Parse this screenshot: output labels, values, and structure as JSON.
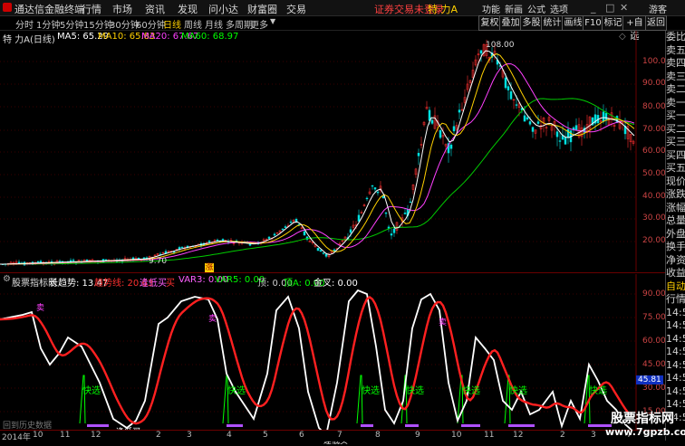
{
  "titlebar": {
    "app": "通达信金融终端",
    "menu": [
      "行情",
      "市场",
      "资讯",
      "发现",
      "问小达",
      "财富圈",
      "交易"
    ],
    "notice": "证券交易未登录",
    "stock_title": "特 力A",
    "right": [
      "功能",
      "新画",
      "公式",
      "选项"
    ],
    "guest": "游客"
  },
  "periodbar": {
    "periods": [
      "分时",
      "1分钟",
      "5分钟",
      "15分钟",
      "30分钟",
      "60分钟",
      "日线",
      "周线",
      "月线",
      "多周期",
      "更多"
    ],
    "active": "日线",
    "tools": [
      "复权",
      "叠加",
      "多股",
      "统计",
      "画线",
      "F10",
      "标记",
      "+自选",
      "返回"
    ]
  },
  "main": {
    "header": {
      "name": "特 力A(日线)",
      "ma5": "MA5: 65.29",
      "ma10": "MA10: 65.83",
      "ma20": "MA20: 67.67",
      "ma60": "MA60: 68.97"
    },
    "high_label": "108.00",
    "low_label": "9.70",
    "marker": "涨",
    "price_ticks": [
      "100.0",
      "90.00",
      "80.00",
      "70.00",
      "60.00",
      "50.00",
      "40.00",
      "30.00",
      "20.00"
    ]
  },
  "indicator": {
    "title": "股票指标网",
    "items": [
      {
        "text": "长趋势: 13.47",
        "color": "#ffffff"
      },
      {
        "text": "趋势线: 20.63",
        "color": "#ff3030"
      },
      {
        "text": "逢低买",
        "color": "#ff60ff"
      },
      {
        "text": "买",
        "color": "#ff3030"
      },
      {
        "text": "VAR3: 0.00",
        "color": "#ff60ff"
      },
      {
        "text": "VAR5: 0.00",
        "color": "#00ff00"
      },
      {
        "text": "顶: 0.00",
        "color": "#cccccc"
      },
      {
        "text": "顶A: 0.00",
        "color": "#00ff00"
      },
      {
        "text": "金叉: 0.00",
        "color": "#ffffff"
      }
    ],
    "ticks": [
      "90.00",
      "75.00",
      "60.00",
      "45.00",
      "30.00",
      "15.00"
    ],
    "current": "45.81",
    "buy_signal": "快选",
    "dip_label": "逢低买",
    "top_label": "卖",
    "bottom_text": "回到历史数据"
  },
  "side": [
    "委比",
    "卖五",
    "卖四",
    "卖三",
    "卖二",
    "卖一",
    "买一",
    "买二",
    "买三",
    "买四",
    "买五",
    "现价",
    "涨跌",
    "涨幅",
    "总量",
    "外盘",
    "换手",
    "净资",
    "收益",
    "自动",
    "行情",
    "14:50",
    "14:50",
    "14:50",
    "14:50",
    "14:50",
    "14:50",
    "14:50",
    "14:50",
    "14:50"
  ],
  "timeaxis": {
    "labels": [
      "2014年",
      "10",
      "11",
      "12",
      "2",
      "3",
      "4",
      "5",
      "6",
      "7",
      "8",
      "9",
      "10",
      "11",
      "12",
      "2",
      "3",
      "4"
    ]
  },
  "watermark": "股票指标网",
  "watermark_url": "www.7gpzb.com"
}
